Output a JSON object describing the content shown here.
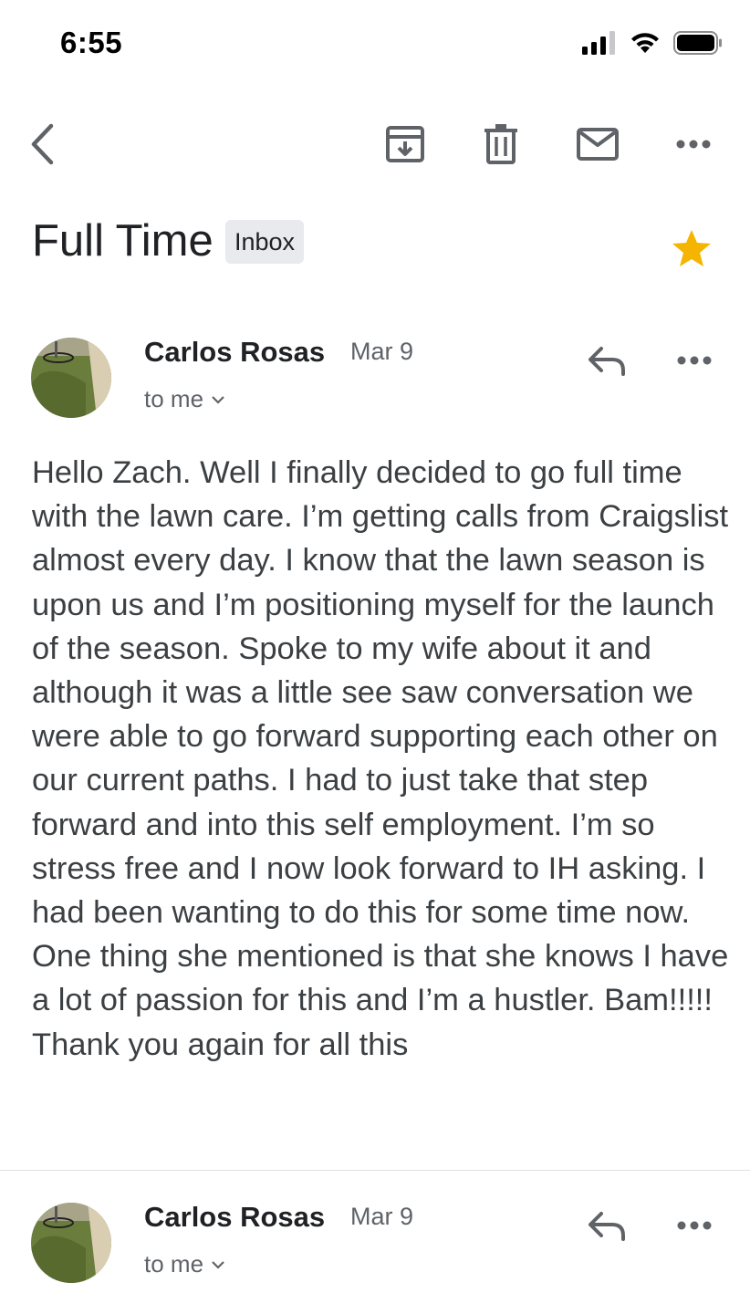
{
  "status_bar": {
    "time": "6:55"
  },
  "toolbar": {
    "back": "back-arrow",
    "actions": [
      "archive-icon",
      "delete-icon",
      "mark-unread-icon",
      "more-icon"
    ]
  },
  "subject": {
    "title": "Full Time",
    "label": "Inbox",
    "starred": true,
    "star_color": "#f4b400"
  },
  "messages": [
    {
      "sender": "Carlos Rosas",
      "date": "Mar 9",
      "recipient": "to me",
      "body": "Hello Zach. Well I finally decided to go full time with the lawn care. I’m getting calls from Craigslist almost every day. I know that the lawn season is upon us and I’m positioning myself for the launch of the season. Spoke to my wife about it and although it was a little see saw conversation we were able to go forward supporting each other on our current paths. I had to just take that step forward and into this self employment. I’m so stress free and I now look forward to IH asking. I had been wanting to do this for some time now. One thing she mentioned is that she knows I have a lot of passion for this and I’m a hustler. Bam!!!!! Thank you again for all this"
    },
    {
      "sender": "Carlos Rosas",
      "date": "Mar 9",
      "recipient": "to me"
    }
  ],
  "colors": {
    "icon": "#5f6368",
    "text": "#202124",
    "muted": "#5f6368"
  }
}
